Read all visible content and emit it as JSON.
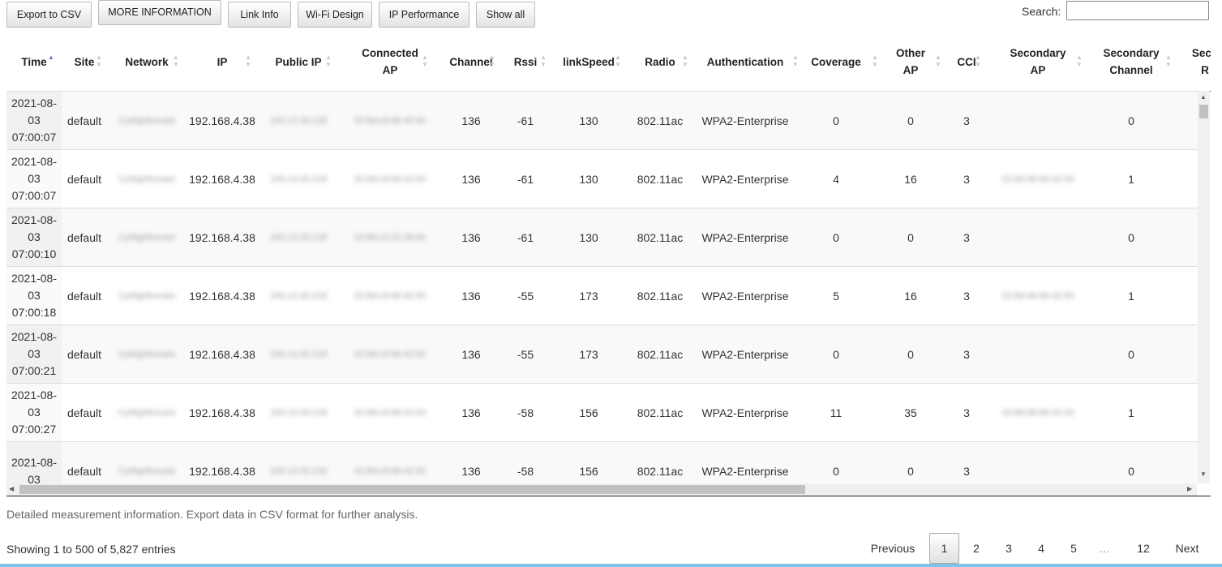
{
  "toolbar": {
    "export_csv": "Export to CSV",
    "more_info": "MORE INFORMATION",
    "link_info": "Link Info",
    "wifi_design": "Wi-Fi Design",
    "ip_performance": "IP Performance",
    "show_all": "Show all"
  },
  "search": {
    "label": "Search:",
    "value": ""
  },
  "columns": [
    {
      "line1": "Time",
      "line2": "",
      "sort": "asc"
    },
    {
      "line1": "Site",
      "line2": "",
      "sort": "both"
    },
    {
      "line1": "Network",
      "line2": "",
      "sort": "both"
    },
    {
      "line1": "IP",
      "line2": "",
      "sort": "both"
    },
    {
      "line1": "Public IP",
      "line2": "",
      "sort": "both"
    },
    {
      "line1": "Connected",
      "line2": "AP",
      "sort": "both"
    },
    {
      "line1": "Channel",
      "line2": "",
      "sort": "both"
    },
    {
      "line1": "Rssi",
      "line2": "",
      "sort": "both"
    },
    {
      "line1": "linkSpeed",
      "line2": "",
      "sort": "both"
    },
    {
      "line1": "Radio",
      "line2": "",
      "sort": "both"
    },
    {
      "line1": "Authentication",
      "line2": "",
      "sort": "both"
    },
    {
      "line1": "Coverage",
      "line2": "",
      "sort": "both"
    },
    {
      "line1": "Other",
      "line2": "AP",
      "sort": "both"
    },
    {
      "line1": "CCI",
      "line2": "",
      "sort": "both"
    },
    {
      "line1": "Secondary",
      "line2": "AP",
      "sort": "both"
    },
    {
      "line1": "Secondary",
      "line2": "Channel",
      "sort": "both"
    },
    {
      "line1": "Seco",
      "line2": "R",
      "sort": "both"
    }
  ],
  "rows": [
    {
      "date1": "2021-08-",
      "date2": "03",
      "time": "07:00:07",
      "site": "default",
      "network": "CyWgrfencare",
      "ip": "192.168.4.38",
      "public_ip": "193.13.33.218",
      "connected_ap": "02:8d:c6:6b:42:00",
      "channel": "136",
      "rssi": "-61",
      "link_speed": "130",
      "radio": "802.11ac",
      "auth": "WPA2-Enterprise",
      "coverage": "0",
      "other_ap": "0",
      "cci": "3",
      "secondary_ap": "",
      "secondary_channel": "0"
    },
    {
      "date1": "2021-08-",
      "date2": "03",
      "time": "07:00:07",
      "site": "default",
      "network": "CyWgrfencare",
      "ip": "192.168.4.38",
      "public_ip": "193.13.33.218",
      "connected_ap": "02:8d:c6:6b:42:00",
      "channel": "136",
      "rssi": "-61",
      "link_speed": "130",
      "radio": "802.11ac",
      "auth": "WPA2-Enterprise",
      "coverage": "4",
      "other_ap": "16",
      "cci": "3",
      "secondary_ap": "02:8d:d6:6b:42:00",
      "secondary_channel": "1"
    },
    {
      "date1": "2021-08-",
      "date2": "03",
      "time": "07:00:10",
      "site": "default",
      "network": "CyWgrfencare",
      "ip": "192.168.4.38",
      "public_ip": "193.13.33.218",
      "connected_ap": "02:8d:c2:22:28:00",
      "channel": "136",
      "rssi": "-61",
      "link_speed": "130",
      "radio": "802.11ac",
      "auth": "WPA2-Enterprise",
      "coverage": "0",
      "other_ap": "0",
      "cci": "3",
      "secondary_ap": "",
      "secondary_channel": "0"
    },
    {
      "date1": "2021-08-",
      "date2": "03",
      "time": "07:00:18",
      "site": "default",
      "network": "CyWgrfencare",
      "ip": "192.168.4.38",
      "public_ip": "193.13.33.218",
      "connected_ap": "02:8d:c6:6b:d2:00",
      "channel": "136",
      "rssi": "-55",
      "link_speed": "173",
      "radio": "802.11ac",
      "auth": "WPA2-Enterprise",
      "coverage": "5",
      "other_ap": "16",
      "cci": "3",
      "secondary_ap": "02:8d:d6:6b:42:00",
      "secondary_channel": "1"
    },
    {
      "date1": "2021-08-",
      "date2": "03",
      "time": "07:00:21",
      "site": "default",
      "network": "CyWgrfencare",
      "ip": "192.168.4.38",
      "public_ip": "193.13.33.218",
      "connected_ap": "02:8d:c6:6b:42:00",
      "channel": "136",
      "rssi": "-55",
      "link_speed": "173",
      "radio": "802.11ac",
      "auth": "WPA2-Enterprise",
      "coverage": "0",
      "other_ap": "0",
      "cci": "3",
      "secondary_ap": "",
      "secondary_channel": "0"
    },
    {
      "date1": "2021-08-",
      "date2": "03",
      "time": "07:00:27",
      "site": "default",
      "network": "CyWgrfencare",
      "ip": "192.168.4.38",
      "public_ip": "193.13.33.218",
      "connected_ap": "02:8d:c6:6b:42:00",
      "channel": "136",
      "rssi": "-58",
      "link_speed": "156",
      "radio": "802.11ac",
      "auth": "WPA2-Enterprise",
      "coverage": "11",
      "other_ap": "35",
      "cci": "3",
      "secondary_ap": "02:8d:d6:6b:42:00",
      "secondary_channel": "1"
    },
    {
      "date1": "2021-08-",
      "date2": "03",
      "time": "",
      "site": "default",
      "network": "CyWgrfencare",
      "ip": "192.168.4.38",
      "public_ip": "193.13.33.218",
      "connected_ap": "02:8d:c6:6b:42:00",
      "channel": "136",
      "rssi": "-58",
      "link_speed": "156",
      "radio": "802.11ac",
      "auth": "WPA2-Enterprise",
      "coverage": "0",
      "other_ap": "0",
      "cci": "3",
      "secondary_ap": "",
      "secondary_channel": "0"
    }
  ],
  "caption": "Detailed measurement information. Export data in CSV format for further analysis.",
  "info": "Showing 1 to 500 of 5,827 entries",
  "pagination": {
    "previous": "Previous",
    "pages": [
      "1",
      "2",
      "3",
      "4",
      "5"
    ],
    "ellipsis": "…",
    "last": "12",
    "next": "Next",
    "current": "1"
  },
  "icons": {
    "sort_asc": "triangle-up-icon",
    "sort_both": "sort-both-icon",
    "scroll_up": "triangle-up-icon",
    "scroll_down": "triangle-down-icon",
    "scroll_left": "triangle-left-icon",
    "scroll_right": "triangle-right-icon"
  },
  "colors": {
    "sort_active": "#6a7bc0",
    "sort_inactive": "#c9c9c9",
    "bottom_bar": "#7ec4e8"
  }
}
